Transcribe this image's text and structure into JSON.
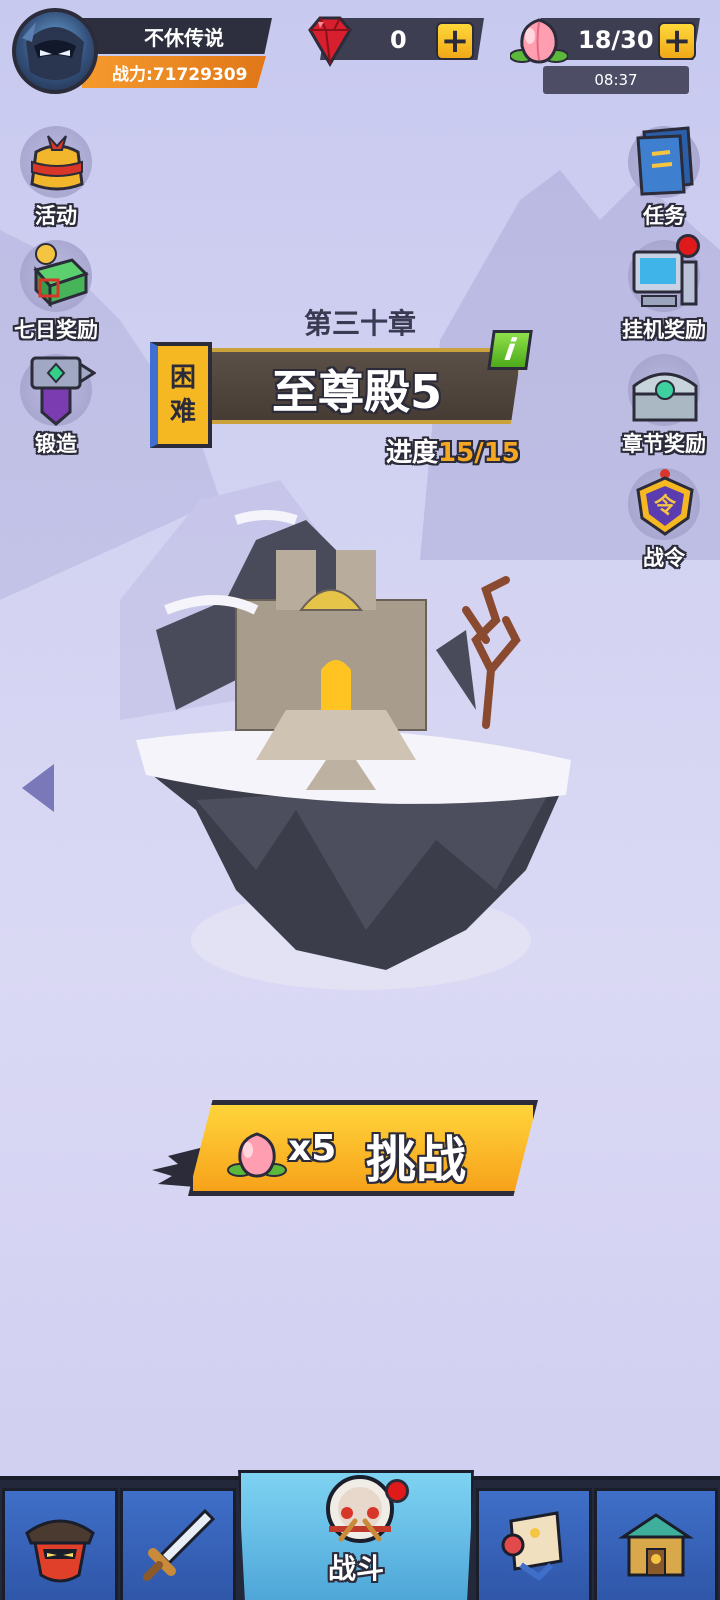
{
  "player": {
    "name": "不休传说",
    "power_label": "战力:",
    "power_value": "71729309"
  },
  "resources": {
    "gems": "0",
    "stamina": "18/30",
    "stamina_timer": "08:37"
  },
  "left_menu": [
    "活动",
    "七日奖励",
    "锻造"
  ],
  "right_menu": [
    "任务",
    "挂机奖励",
    "章节奖励",
    "战令"
  ],
  "chapter": {
    "title": "第三十章",
    "difficulty": [
      "困",
      "难"
    ],
    "stage_name": "至尊殿5",
    "info_label": "i",
    "progress_label": "进度",
    "progress_value": "15/15",
    "progress_current": 15,
    "progress_total": 15
  },
  "challenge": {
    "cost": "x5",
    "label": "挑战"
  },
  "bottom_nav": {
    "active_label": "战斗"
  },
  "colors": {
    "accent": "#f7a21a",
    "nav_blue": "#2f56a8",
    "active_tab": "#4ea6d8",
    "difficulty_tag": "#f5b823"
  }
}
